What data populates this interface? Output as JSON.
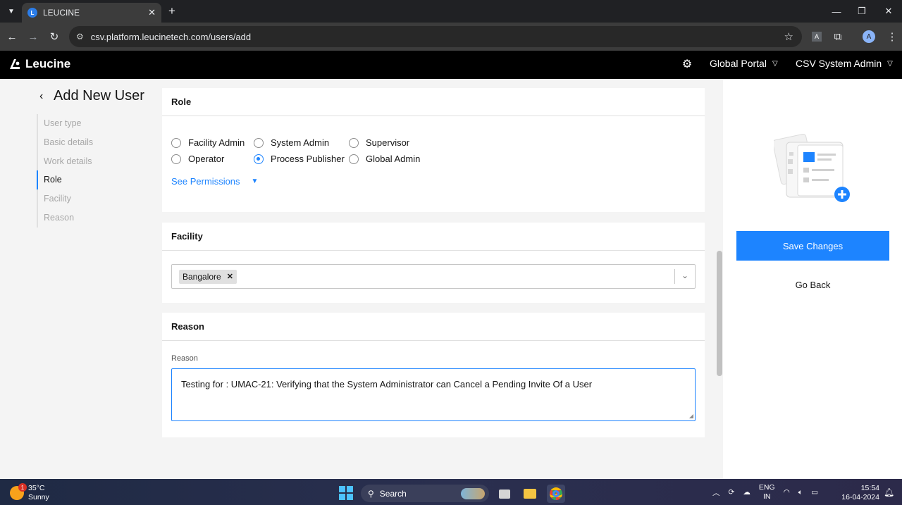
{
  "browser": {
    "tab_title": "LEUCINE",
    "url": "csv.platform.leucinetech.com/users/add",
    "profile_initial": "A"
  },
  "app": {
    "brand": "Leucine",
    "portal_dropdown": "Global Portal",
    "user_dropdown": "CSV System Admin"
  },
  "sidebar": {
    "title": "Add New User",
    "steps": [
      {
        "label": "User type",
        "active": false
      },
      {
        "label": "Basic details",
        "active": false
      },
      {
        "label": "Work details",
        "active": false
      },
      {
        "label": "Role",
        "active": true
      },
      {
        "label": "Facility",
        "active": false
      },
      {
        "label": "Reason",
        "active": false
      }
    ]
  },
  "role": {
    "header": "Role",
    "options": [
      {
        "label": "Facility Admin",
        "selected": false
      },
      {
        "label": "System Admin",
        "selected": false
      },
      {
        "label": "Supervisor",
        "selected": false
      },
      {
        "label": "Operator",
        "selected": false
      },
      {
        "label": "Process Publisher",
        "selected": true
      },
      {
        "label": "Global Admin",
        "selected": false
      }
    ],
    "see_permissions": "See Permissions"
  },
  "facility": {
    "header": "Facility",
    "selected_chips": [
      "Bangalore"
    ]
  },
  "reason": {
    "header": "Reason",
    "field_label": "Reason",
    "value": "Testing for : UMAC-21: Verifying that the System Administrator can Cancel a Pending Invite Of a User"
  },
  "actions": {
    "save_label": "Save Changes",
    "back_label": "Go Back"
  },
  "colors": {
    "accent": "#1d84ff",
    "header_bg": "#000000"
  },
  "taskbar": {
    "weather_temp": "35°C",
    "weather_desc": "Sunny",
    "weather_badge": "1",
    "search_label": "Search",
    "lang_top": "ENG",
    "lang_bottom": "IN",
    "time": "15:54",
    "date": "16-04-2024"
  }
}
